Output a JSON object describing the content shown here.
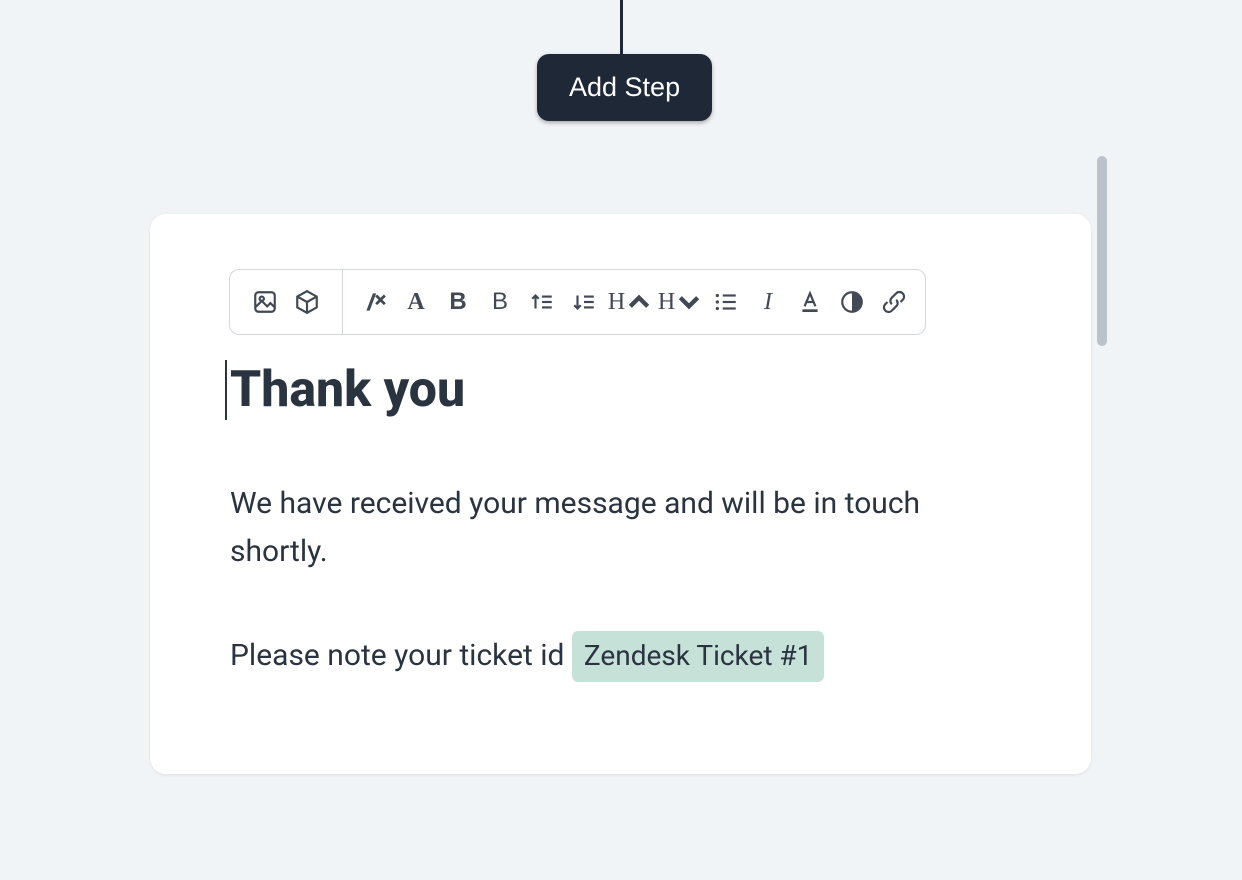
{
  "header": {
    "add_step_label": "Add Step"
  },
  "toolbar": {
    "icons": {
      "image": "image-icon",
      "cube": "cube-icon",
      "clear_format": "clear-format-icon",
      "font_a_serif": "A",
      "bold_b": "B",
      "light_b": "B",
      "sort_asc": "sort-asc-icon",
      "sort_desc": "sort-desc-icon",
      "heading_up": "H",
      "heading_down": "H",
      "bullet_list": "bullet-list-icon",
      "italic": "I",
      "underline_a": "underline-icon",
      "ink": "ink-icon",
      "link": "link-icon"
    }
  },
  "content": {
    "heading": "Thank you",
    "paragraph1": "We have received your message and will be in touch shortly.",
    "paragraph2_prefix": "Please note your ticket id ",
    "chip_label": "Zendesk Ticket #1"
  }
}
